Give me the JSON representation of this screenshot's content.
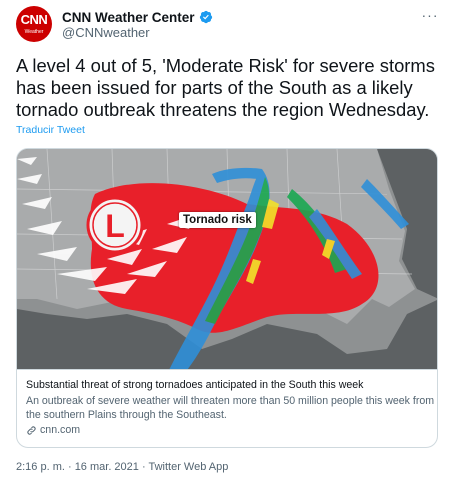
{
  "account": {
    "display_name": "CNN Weather Center",
    "handle": "@CNNweather",
    "avatar_logo": "CNN",
    "avatar_sub": "Weather",
    "verified_icon": "verified-badge-icon",
    "more_icon": "more-options-icon",
    "more_glyph": "···"
  },
  "tweet": {
    "text": "A level 4 out of 5, 'Moderate Risk' for severe storms has been issued for parts of the South as a likely tornado outbreak threatens the region Wednesday.",
    "translate_label": "Traducir Tweet"
  },
  "card": {
    "image_label": "Tornado risk",
    "image_logo_letter": "L",
    "title": "Substantial threat of strong tornadoes anticipated in the South this week",
    "description": "An outbreak of severe weather will threaten more than 50 million people this week from the southern Plains through the Southeast.",
    "domain": "cnn.com",
    "link_icon": "link-icon"
  },
  "meta": {
    "timestamp": "2:16 p. m. · 16 mar. 2021 · Twitter Web App"
  },
  "colors": {
    "accent": "#1d9bf0",
    "brand_red": "#cc0000",
    "text_primary": "#0f1419",
    "text_secondary": "#536471",
    "border": "#cfd9de",
    "risk_red": "#e8202a"
  }
}
